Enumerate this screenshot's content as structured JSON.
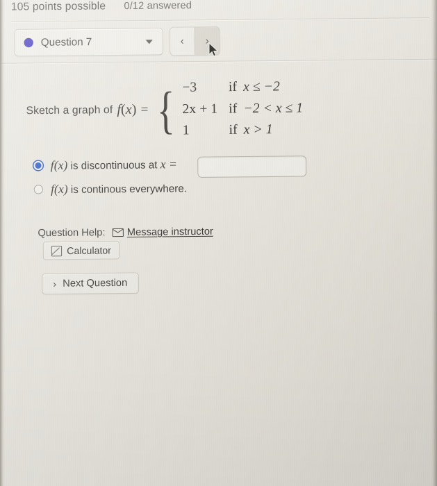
{
  "status": {
    "points_possible": "105 points possible",
    "answered": "0/12 answered"
  },
  "question_selector": {
    "label": "Question 7",
    "dot_icon": "filled-circle-icon",
    "dot_color": "#2318b4",
    "caret_icon": "chevron-down-icon"
  },
  "navigation": {
    "prev_label": "‹",
    "prev_icon": "chevron-left-icon",
    "next_label": "›",
    "next_icon": "chevron-right-icon",
    "next_state": "hovered"
  },
  "problem": {
    "prompt": "Sketch a graph of",
    "function_name": "f(x)",
    "equals": "=",
    "cases": [
      {
        "value": "−3",
        "if": "if",
        "condition": "x ≤ −2"
      },
      {
        "value": "2x + 1",
        "if": "if",
        "condition": "−2 < x ≤ 1"
      },
      {
        "value": "1",
        "if": "if",
        "condition": "x > 1"
      }
    ]
  },
  "options": [
    {
      "id": "discontinuous",
      "math": "f(x)",
      "text": " is discontinuous at ",
      "math_tail": "x",
      "equals": " =",
      "selected": true,
      "has_input": true,
      "input_value": "",
      "input_placeholder": ""
    },
    {
      "id": "continuous",
      "math": "f(x)",
      "text": " is continous everywhere.",
      "math_tail": "",
      "equals": "",
      "selected": false,
      "has_input": false
    }
  ],
  "help": {
    "label": "Question Help:",
    "message_link": "Message instructor",
    "envelope_icon": "envelope-icon",
    "calculator_label": "Calculator",
    "calculator_icon": "graph-icon"
  },
  "footer": {
    "next_question_label": "Next Question",
    "next_question_icon": "chevron-right-icon"
  },
  "theme": {
    "background": "#e6e3db",
    "radio_selected": "#1f4fc4",
    "text": "#2e2b27",
    "border": "#c8c3b8"
  }
}
